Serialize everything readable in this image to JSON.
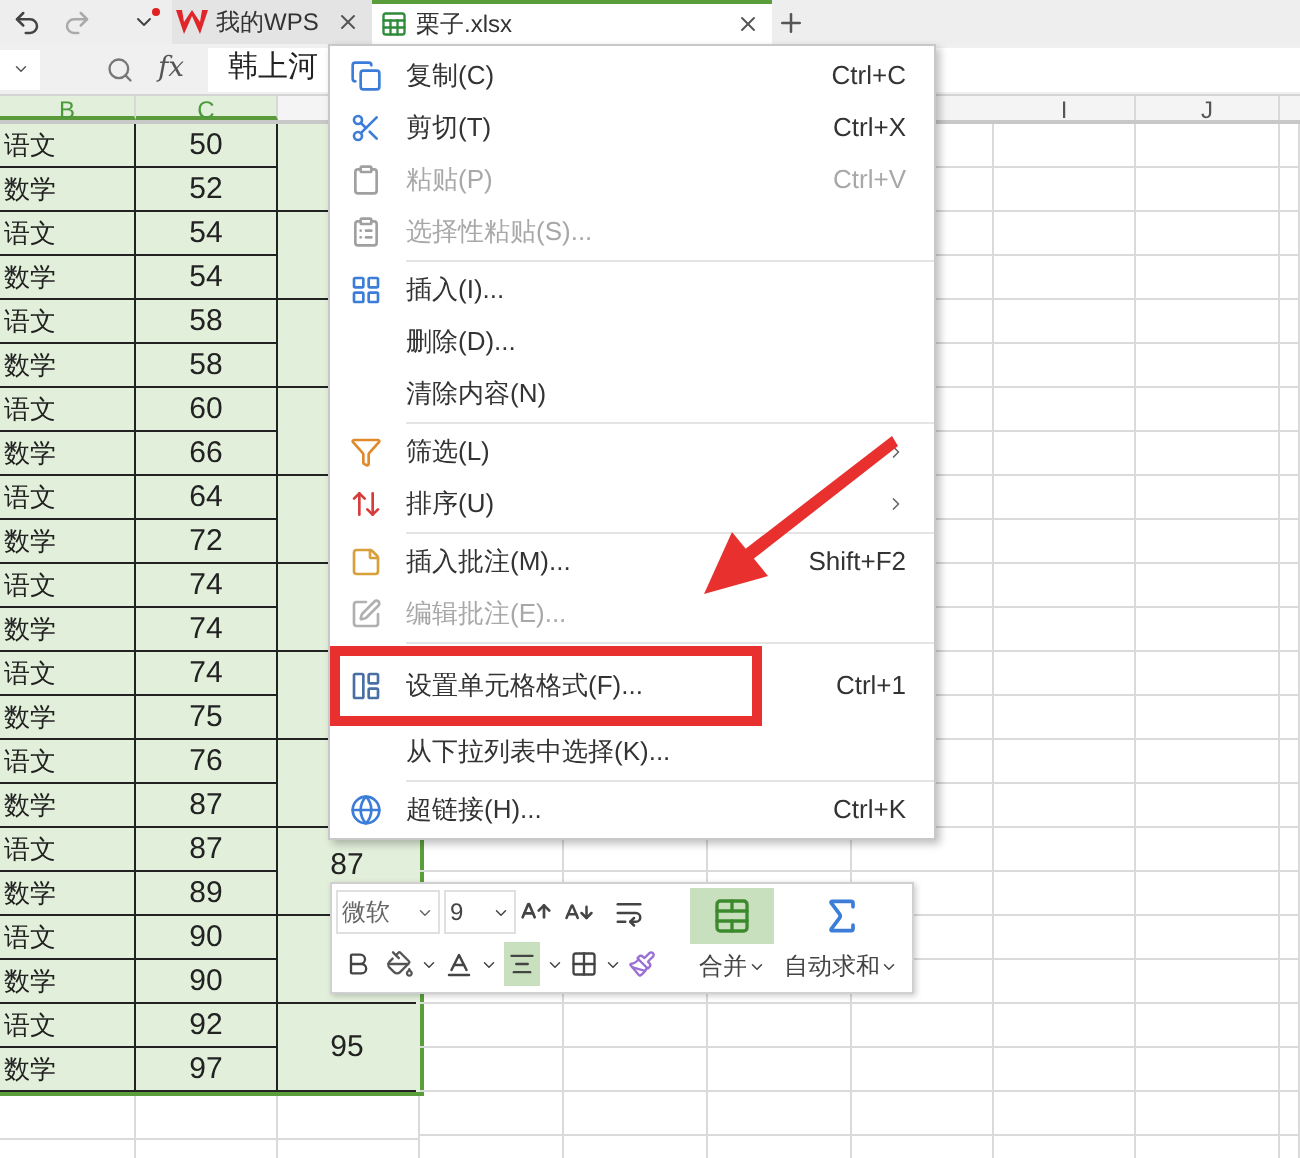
{
  "tabs": [
    {
      "label": "我的WPS",
      "selected": false
    },
    {
      "label": "栗子.xlsx",
      "selected": true
    }
  ],
  "formula_bar": {
    "function_label": "fx",
    "value": "韩上河"
  },
  "column_headers": [
    {
      "label": "B",
      "selected": true
    },
    {
      "label": "C",
      "selected": true
    },
    {
      "label": "I",
      "selected": false
    },
    {
      "label": "J",
      "selected": false
    }
  ],
  "rows": [
    {
      "b": "语文",
      "c": "50"
    },
    {
      "b": "数学",
      "c": "52"
    },
    {
      "b": "语文",
      "c": "54"
    },
    {
      "b": "数学",
      "c": "54"
    },
    {
      "b": "语文",
      "c": "58"
    },
    {
      "b": "数学",
      "c": "58"
    },
    {
      "b": "语文",
      "c": "60"
    },
    {
      "b": "数学",
      "c": "66"
    },
    {
      "b": "语文",
      "c": "64"
    },
    {
      "b": "数学",
      "c": "72"
    },
    {
      "b": "语文",
      "c": "74"
    },
    {
      "b": "数学",
      "c": "74"
    },
    {
      "b": "语文",
      "c": "74"
    },
    {
      "b": "数学",
      "c": "75"
    },
    {
      "b": "语文",
      "c": "76"
    },
    {
      "b": "数学",
      "c": "87"
    },
    {
      "b": "语文",
      "c": "87"
    },
    {
      "b": "数学",
      "c": "89"
    },
    {
      "b": "语文",
      "c": "90"
    },
    {
      "b": "数学",
      "c": "90"
    },
    {
      "b": "语文",
      "c": "92"
    },
    {
      "b": "数学",
      "c": "97"
    }
  ],
  "column_d": [
    {
      "kind": "blank"
    },
    {
      "kind": "blank"
    },
    {
      "kind": "blank"
    },
    {
      "kind": "blank"
    },
    {
      "kind": "blank"
    },
    {
      "kind": "blank"
    },
    {
      "kind": "blank"
    },
    {
      "kind": "blank"
    },
    {
      "kind": "value",
      "value": "87"
    },
    {
      "kind": "blank"
    },
    {
      "kind": "value",
      "value": "95"
    }
  ],
  "context_menu": [
    {
      "kind": "item",
      "label": "复制(C)",
      "shortcut": "Ctrl+C",
      "disabled": false
    },
    {
      "kind": "item",
      "label": "剪切(T)",
      "shortcut": "Ctrl+X",
      "disabled": false
    },
    {
      "kind": "item",
      "label": "粘贴(P)",
      "shortcut": "Ctrl+V",
      "disabled": true
    },
    {
      "kind": "item",
      "label": "选择性粘贴(S)...",
      "disabled": true
    },
    {
      "kind": "separator"
    },
    {
      "kind": "item",
      "label": "插入(I)...",
      "disabled": false
    },
    {
      "kind": "item",
      "label": "删除(D)...",
      "disabled": false
    },
    {
      "kind": "item",
      "label": "清除内容(N)",
      "disabled": false
    },
    {
      "kind": "separator"
    },
    {
      "kind": "item",
      "label": "筛选(L)",
      "disabled": false,
      "submenu": true
    },
    {
      "kind": "item",
      "label": "排序(U)",
      "disabled": false,
      "submenu": true
    },
    {
      "kind": "separator"
    },
    {
      "kind": "item",
      "label": "插入批注(M)...",
      "shortcut": "Shift+F2",
      "disabled": false
    },
    {
      "kind": "item",
      "label": "编辑批注(E)...",
      "disabled": true
    },
    {
      "kind": "separator"
    },
    {
      "kind": "item",
      "label": "设置单元格格式(F)...",
      "shortcut": "Ctrl+1",
      "disabled": false,
      "highlighted": true
    },
    {
      "kind": "item",
      "label": "从下拉列表中选择(K)...",
      "disabled": false
    },
    {
      "kind": "separator"
    },
    {
      "kind": "item",
      "label": "超链接(H)...",
      "shortcut": "Ctrl+K",
      "disabled": false
    }
  ],
  "mini_toolbar": {
    "font": "微软",
    "size": "9",
    "align_selected": true,
    "merge_selected": true,
    "merge_label": "合并",
    "autosum_label": "自动求和"
  }
}
